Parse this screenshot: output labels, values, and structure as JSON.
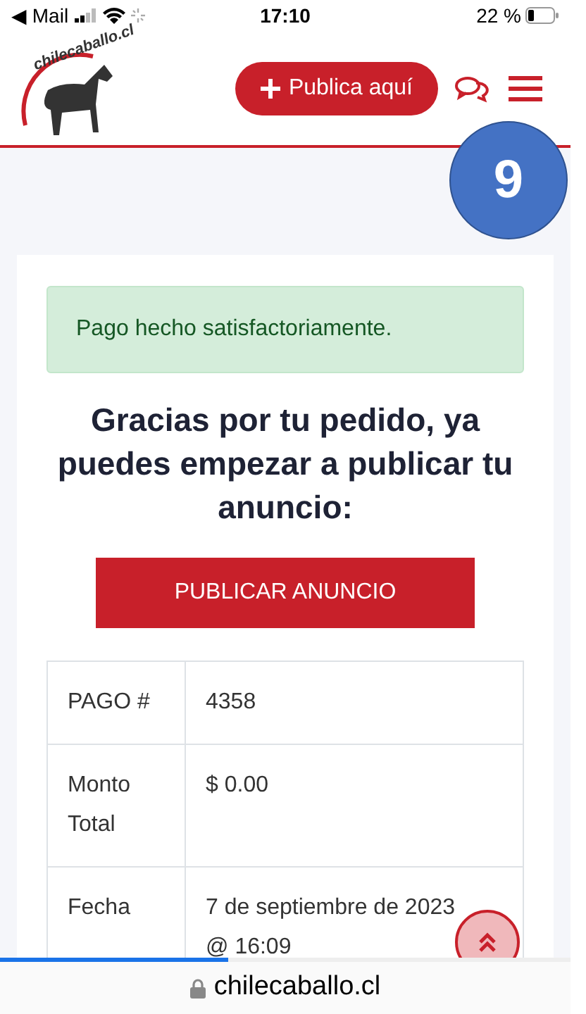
{
  "status_bar": {
    "back": "◀ Mail",
    "time": "17:10",
    "battery": "22 %"
  },
  "header": {
    "logo_text": "chilecaballo.cl",
    "publish_button": "Publica aquí"
  },
  "step_badge": "9",
  "alert": "Pago hecho satisfactoriamente.",
  "heading": "Gracias por tu pedido, ya puedes empezar a publicar tu anuncio:",
  "publish_ad_button": "PUBLICAR ANUNCIO",
  "table": {
    "rows": [
      {
        "label": "PAGO #",
        "value": "4358"
      },
      {
        "label": "Monto Total",
        "value": "$ 0.00"
      },
      {
        "label": "Fecha",
        "value": "7 de septiembre de 2023 @ 16:09"
      }
    ]
  },
  "page_load": {
    "level": 0.4
  },
  "address_bar": {
    "url": "chilecaballo.cl"
  }
}
